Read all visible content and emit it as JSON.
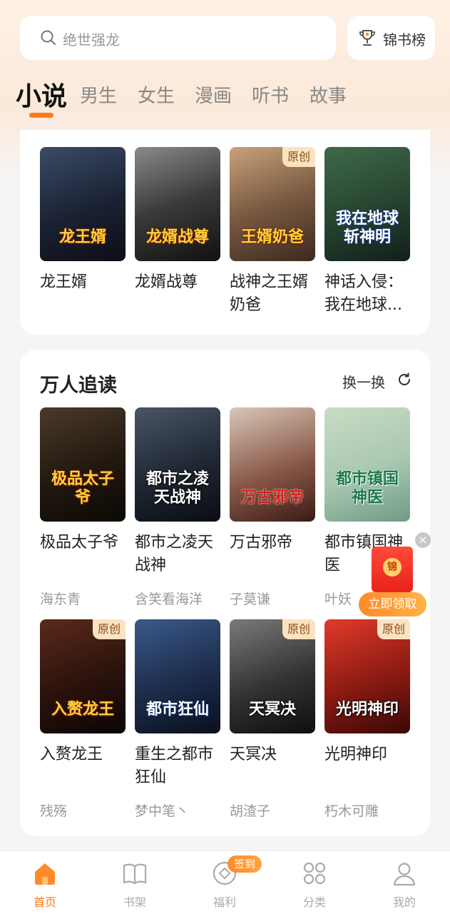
{
  "search": {
    "placeholder": "绝世强龙",
    "icon": "search-icon"
  },
  "rank_button": {
    "label": "锦书榜",
    "icon": "trophy-icon"
  },
  "tabs": [
    {
      "label": "小说",
      "active": true
    },
    {
      "label": "男生"
    },
    {
      "label": "女生"
    },
    {
      "label": "漫画"
    },
    {
      "label": "听书"
    },
    {
      "label": "故事"
    }
  ],
  "colors": {
    "accent": "#ff7a1a",
    "badge_bg": "#fbe3c2",
    "badge_text": "#8a4b16"
  },
  "section1": {
    "books": [
      {
        "title": "龙王婿",
        "cover_text": "龙王婿"
      },
      {
        "title": "龙婿战尊",
        "cover_text": "龙婿战尊"
      },
      {
        "title": "战神之王婿奶爸",
        "cover_text": "王婿奶爸",
        "badge": "原创"
      },
      {
        "title": "神话入侵：我在地球...",
        "cover_text": "我在地球斩神明"
      }
    ]
  },
  "section2": {
    "title": "万人追读",
    "refresh_label": "换一换",
    "books": [
      {
        "title": "极品太子爷",
        "author": "海东青",
        "cover_text": "极品太子爷"
      },
      {
        "title": "都市之凌天战神",
        "author": "含笑看海洋",
        "cover_text": "都市之凌天战神"
      },
      {
        "title": "万古邪帝",
        "author": "子莫谦",
        "cover_text": "万古邪帝"
      },
      {
        "title": "都市镇国神医",
        "author": "叶妖",
        "cover_text": "都市镇国神医"
      },
      {
        "title": "入赘龙王",
        "author": "残殇",
        "cover_text": "入赘龙王",
        "badge": "原创"
      },
      {
        "title": "重生之都市狂仙",
        "author": "梦中笔丶",
        "cover_text": "都市狂仙"
      },
      {
        "title": "天冥决",
        "author": "胡渣子",
        "cover_text": "天冥决",
        "badge": "原创"
      },
      {
        "title": "光明神印",
        "author": "朽木可雕",
        "cover_text": "光明神印",
        "badge": "原创"
      }
    ]
  },
  "floating": {
    "close": "×",
    "coin": "锦",
    "button": "立即领取"
  },
  "bottom_nav": [
    {
      "label": "首页",
      "icon": "home-icon",
      "active": true
    },
    {
      "label": "书架",
      "icon": "bookshelf-icon"
    },
    {
      "label": "福利",
      "icon": "welfare-icon",
      "badge": "签到"
    },
    {
      "label": "分类",
      "icon": "category-icon"
    },
    {
      "label": "我的",
      "icon": "profile-icon"
    }
  ]
}
